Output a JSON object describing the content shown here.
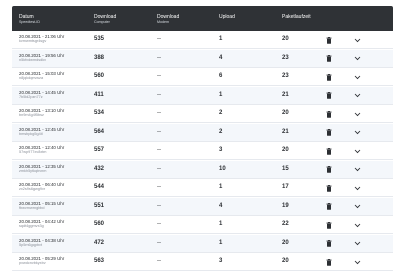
{
  "table": {
    "columns": {
      "datum": "Datum",
      "datum_sub": "Speedtest-ID",
      "download_computer": "Download",
      "download_computer_sub": "Computer",
      "download_modem": "Download",
      "download_modem_sub": "Modem",
      "upload": "Upload",
      "paketlaufzeit": "Paketlaufzeit"
    },
    "rows": [
      {
        "date": "20.08.2021 - 21:06 Uhr",
        "id": "kvmwmtsgr4sgv",
        "download": "535",
        "modem": "--",
        "upload": "1",
        "latency": "20"
      },
      {
        "date": "20.08.2021 - 19:56 Uhr",
        "id": "n5kfxdwmdsdkv",
        "download": "388",
        "modem": "--",
        "upload": "4",
        "latency": "23"
      },
      {
        "date": "20.08.2021 - 15:03 Uhr",
        "id": "n8jqkdqnvwza",
        "download": "560",
        "modem": "--",
        "upload": "6",
        "latency": "23"
      },
      {
        "date": "20.08.2021 - 14:45 Uhr",
        "id": "7b5ld2pzn77z",
        "download": "411",
        "modem": "--",
        "upload": "1",
        "latency": "21"
      },
      {
        "date": "20.08.2021 - 13:10 Uhr",
        "id": "bn9m4g4f5bsz",
        "download": "534",
        "modem": "--",
        "upload": "2",
        "latency": "20"
      },
      {
        "date": "20.08.2021 - 12:45 Uhr",
        "id": "bmsbpkg5g4tl",
        "download": "564",
        "modem": "--",
        "upload": "2",
        "latency": "21"
      },
      {
        "date": "20.08.2021 - 12:40 Uhr",
        "id": "57wp977xv8xtm",
        "download": "557",
        "modem": "--",
        "upload": "3",
        "latency": "20"
      },
      {
        "date": "20.08.2021 - 12:35 Uhr",
        "id": "zmkh5ytkqbvnm",
        "download": "432",
        "modem": "--",
        "upload": "10",
        "latency": "15"
      },
      {
        "date": "20.08.2021 - 06:40 Uhr",
        "id": "zx2s9s6gwg9vr",
        "download": "544",
        "modem": "--",
        "upload": "1",
        "latency": "17"
      },
      {
        "date": "20.08.2021 - 05:15 Uhr",
        "id": "fbwvmwrngbbd",
        "download": "551",
        "modem": "--",
        "upload": "4",
        "latency": "19"
      },
      {
        "date": "20.08.2021 - 04:42 Uhr",
        "id": "sqdt4ggmvx3g",
        "download": "560",
        "modem": "--",
        "upload": "1",
        "latency": "22"
      },
      {
        "date": "20.08.2021 - 04:38 Uhr",
        "id": "5p5m6gqpbvt",
        "download": "472",
        "modem": "--",
        "upload": "1",
        "latency": "20"
      },
      {
        "date": "20.08.2021 - 05:29 Uhr",
        "id": "pxwdcnvbkyxbv",
        "download": "563",
        "modem": "--",
        "upload": "3",
        "latency": "20"
      }
    ]
  },
  "icons": {
    "delete": "trash-icon",
    "expand": "chevron-down-icon"
  },
  "colors": {
    "header_bg": "#2f3236",
    "row_alt_bg": "#f4f7fb"
  }
}
